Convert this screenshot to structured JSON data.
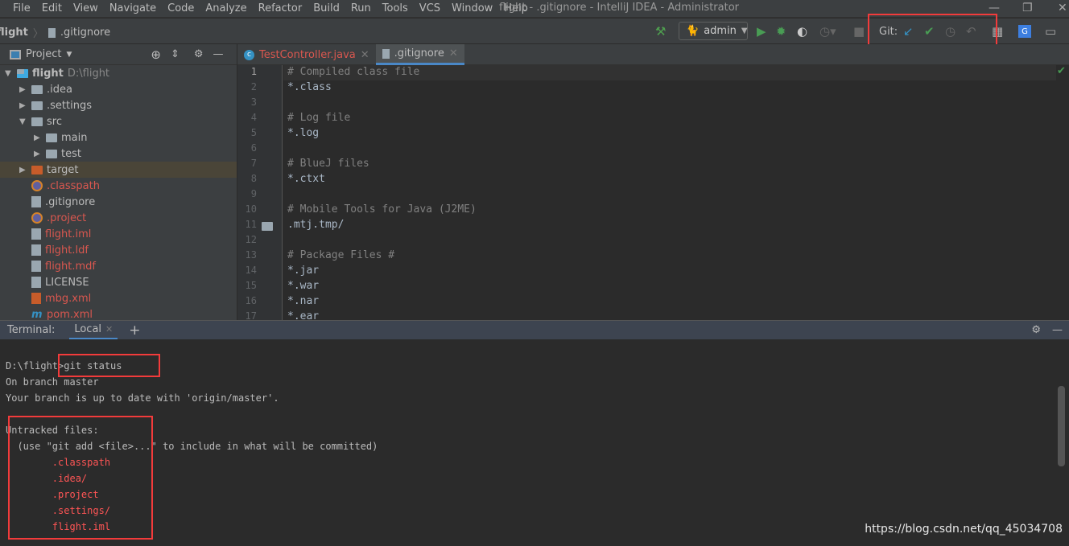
{
  "menubar": {
    "items": [
      "File",
      "Edit",
      "View",
      "Navigate",
      "Code",
      "Analyze",
      "Refactor",
      "Build",
      "Run",
      "Tools",
      "VCS",
      "Window",
      "Help"
    ]
  },
  "window_title": "flight - .gitignore - IntelliJ IDEA - Administrator",
  "breadcrumb": [
    "flight",
    ".gitignore"
  ],
  "toolbar": {
    "run_config": "admin",
    "git_label": "Git:"
  },
  "project_panel": {
    "title": "Project",
    "tree": [
      {
        "label": "flight",
        "extra": "D:\\flight",
        "level": 0,
        "type": "module",
        "expanded": true
      },
      {
        "label": ".idea",
        "level": 1,
        "type": "folder"
      },
      {
        "label": ".settings",
        "level": 1,
        "type": "folder"
      },
      {
        "label": "src",
        "level": 1,
        "type": "folder",
        "expanded": true
      },
      {
        "label": "main",
        "level": 2,
        "type": "folder"
      },
      {
        "label": "test",
        "level": 2,
        "type": "folder"
      },
      {
        "label": "target",
        "level": 1,
        "type": "folder-excluded",
        "selected": true
      },
      {
        "label": ".classpath",
        "level": 1,
        "type": "eclipse",
        "untracked": true
      },
      {
        "label": ".gitignore",
        "level": 1,
        "type": "ignore"
      },
      {
        "label": ".project",
        "level": 1,
        "type": "eclipse",
        "untracked": true
      },
      {
        "label": "flight.iml",
        "level": 1,
        "type": "file",
        "untracked": true
      },
      {
        "label": "flight.ldf",
        "level": 1,
        "type": "file",
        "untracked": true
      },
      {
        "label": "flight.mdf",
        "level": 1,
        "type": "file",
        "untracked": true
      },
      {
        "label": "LICENSE",
        "level": 1,
        "type": "text"
      },
      {
        "label": "mbg.xml",
        "level": 1,
        "type": "xml",
        "untracked": true
      },
      {
        "label": "pom.xml",
        "level": 1,
        "type": "maven",
        "untracked": true
      }
    ]
  },
  "editor_tabs": [
    {
      "label": "TestController.java",
      "active": false,
      "untracked": true
    },
    {
      "label": ".gitignore",
      "active": true
    }
  ],
  "editor_lines": [
    "# Compiled class file",
    "*.class",
    "",
    "# Log file",
    "*.log",
    "",
    "# BlueJ files",
    "*.ctxt",
    "",
    "# Mobile Tools for Java (J2ME)",
    ".mtj.tmp/",
    "",
    "# Package Files #",
    "*.jar",
    "*.war",
    "*.nar",
    "*.ear"
  ],
  "terminal": {
    "title": "Terminal:",
    "tab": "Local",
    "lines": [
      {
        "text": "D:\\flight>git status",
        "red": false
      },
      {
        "text": "On branch master",
        "red": false
      },
      {
        "text": "Your branch is up to date with 'origin/master'.",
        "red": false
      },
      {
        "text": "",
        "red": false
      },
      {
        "text": "Untracked files:",
        "red": false
      },
      {
        "text": "  (use \"git add <file>...\" to include in what will be committed)",
        "red": false
      },
      {
        "text": "        .classpath",
        "red": true
      },
      {
        "text": "        .idea/",
        "red": true
      },
      {
        "text": "        .project",
        "red": true
      },
      {
        "text": "        .settings/",
        "red": true
      },
      {
        "text": "        flight.iml",
        "red": true
      }
    ]
  },
  "watermark": "https://blog.csdn.net/qq_45034708",
  "colors": {
    "untracked": "#d9574f",
    "terminal_red": "#ff5555",
    "highlight_box": "#f23b3b",
    "accent": "#4a88c7"
  }
}
